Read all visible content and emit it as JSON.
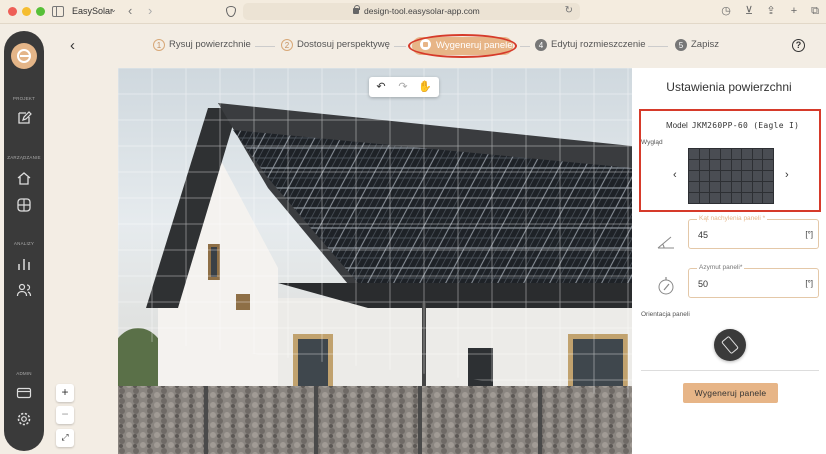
{
  "browser": {
    "app_name": "EasySolar",
    "url": "design-tool.easysolar-app.com"
  },
  "sidebar": {
    "sections": [
      {
        "label": "PROJEKT"
      },
      {
        "label": "ZARZĄDZANIE"
      },
      {
        "label": "ANALIZY"
      },
      {
        "label": "ADMIN"
      }
    ]
  },
  "stepper": {
    "steps": [
      {
        "num": "1",
        "label": "Rysuj powierzchnie",
        "state": "done"
      },
      {
        "num": "2",
        "label": "Dostosuj perspektywę",
        "state": "done"
      },
      {
        "num": "",
        "label": "Wygeneruj panele",
        "state": "active"
      },
      {
        "num": "4",
        "label": "Edytuj rozmieszczenie",
        "state": "pending"
      },
      {
        "num": "5",
        "label": "Zapisz",
        "state": "pending"
      }
    ],
    "help": "?"
  },
  "panel": {
    "title": "Ustawienia powierzchni",
    "model_label": "Model",
    "model_value": "JKM260PP-60 (Eagle I)",
    "look_label": "Wygląd",
    "tilt_label": "Kąt nachylenia paneli *",
    "tilt_value": "45",
    "tilt_unit": "[°]",
    "azimuth_label": "Azymut paneli*",
    "azimuth_value": "50",
    "azimuth_unit": "[°]",
    "orientation_label": "Orientacja paneli",
    "generate_button": "Wygeneruj panele"
  },
  "colors": {
    "accent": "#e7b587",
    "highlight": "#d63a2a",
    "sidebar": "#3a3a3a"
  }
}
